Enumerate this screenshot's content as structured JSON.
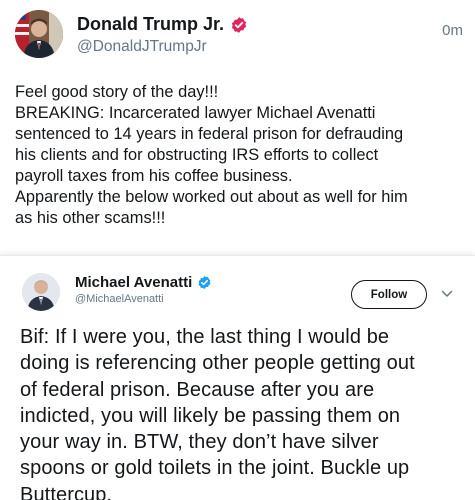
{
  "tweet": {
    "author": {
      "display_name": "Donald Trump Jr.",
      "handle": "@DonaldJTrumpJr",
      "verified": true,
      "avatar": "avatar-photo"
    },
    "time": "0m",
    "text_lines": [
      "Feel good story of the day!!!",
      "BREAKING: Incarcerated lawyer Michael Avenatti",
      "sentenced to 14 years in federal prison for defrauding",
      "his clients and for obstructing IRS efforts to collect",
      "payroll taxes from his coffee business.",
      "Apparently the below worked out about as well for him",
      "as his other scams!!!"
    ]
  },
  "quoted": {
    "author": {
      "display_name": "Michael Avenatti",
      "handle": "@MichaelAvenatti",
      "verified": true,
      "avatar": "avatar-photo"
    },
    "follow_label": "Follow",
    "text_lines": [
      "Bif: If I were you, the last thing I would be",
      "doing is referencing other people getting out",
      "of federal prison. Because after you are",
      "indicted, you will likely be passing them on",
      "your way in. BTW, they don’t have silver",
      "spoons or gold toilets in the joint. Buckle up",
      "Buttercup."
    ]
  },
  "colors": {
    "verified": "#1da1f2",
    "secondary_text": "#657786",
    "primary_text": "#14171a"
  },
  "icons": [
    "verified-badge-icon",
    "chevron-down-icon"
  ]
}
